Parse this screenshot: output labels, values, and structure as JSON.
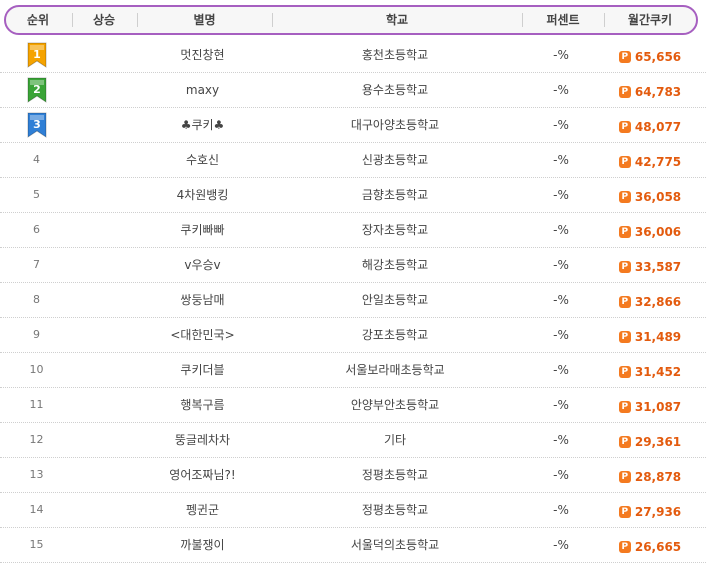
{
  "header": {
    "rank": "순위",
    "rise": "상승",
    "nickname": "별명",
    "school": "학교",
    "percent": "퍼센트",
    "monthly_cookie": "월간쿠키"
  },
  "medal_colors": [
    "#f5a300",
    "#3aa437",
    "#2f7fd6"
  ],
  "cookie_color": "#e35b0e",
  "rows": [
    {
      "rank": "1",
      "nickname": "멋진창현",
      "school": "홍천초등학교",
      "percent": "-%",
      "cookie": "65,656"
    },
    {
      "rank": "2",
      "nickname": "maxy",
      "school": "용수초등학교",
      "percent": "-%",
      "cookie": "64,783"
    },
    {
      "rank": "3",
      "nickname": "♣쿠키♣",
      "school": "대구아양초등학교",
      "percent": "-%",
      "cookie": "48,077"
    },
    {
      "rank": "4",
      "nickname": "수호신",
      "school": "신광초등학교",
      "percent": "-%",
      "cookie": "42,775"
    },
    {
      "rank": "5",
      "nickname": "4차원뱅킹",
      "school": "금향초등학교",
      "percent": "-%",
      "cookie": "36,058"
    },
    {
      "rank": "6",
      "nickname": "쿠키빠빠",
      "school": "장자초등학교",
      "percent": "-%",
      "cookie": "36,006"
    },
    {
      "rank": "7",
      "nickname": "v우승v",
      "school": "해강초등학교",
      "percent": "-%",
      "cookie": "33,587"
    },
    {
      "rank": "8",
      "nickname": "쌍둥남매",
      "school": "안일초등학교",
      "percent": "-%",
      "cookie": "32,866"
    },
    {
      "rank": "9",
      "nickname": "<대한민국>",
      "school": "강포초등학교",
      "percent": "-%",
      "cookie": "31,489"
    },
    {
      "rank": "10",
      "nickname": "쿠키더블",
      "school": "서울보라매초등학교",
      "percent": "-%",
      "cookie": "31,452"
    },
    {
      "rank": "11",
      "nickname": "행복구름",
      "school": "안양부안초등학교",
      "percent": "-%",
      "cookie": "31,087"
    },
    {
      "rank": "12",
      "nickname": "뚱글레차차",
      "school": "기타",
      "percent": "-%",
      "cookie": "29,361"
    },
    {
      "rank": "13",
      "nickname": "영어조짜님?!",
      "school": "정평초등학교",
      "percent": "-%",
      "cookie": "28,878"
    },
    {
      "rank": "14",
      "nickname": "펭귄군",
      "school": "정평초등학교",
      "percent": "-%",
      "cookie": "27,936"
    },
    {
      "rank": "15",
      "nickname": "까불쟁이",
      "school": "서울덕의초등학교",
      "percent": "-%",
      "cookie": "26,665"
    }
  ]
}
